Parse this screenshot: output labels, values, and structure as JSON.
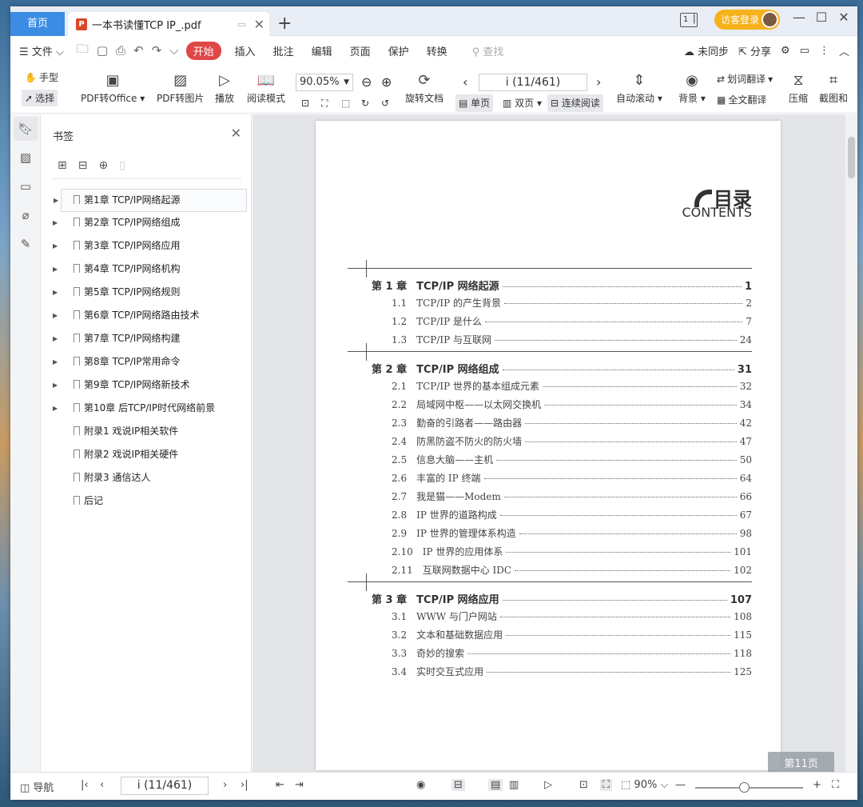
{
  "titlebar": {
    "home_tab": "首页",
    "doc_tab": "一本书读懂TCP IP_.pdf",
    "pdf_badge": "P",
    "new_tab": "+",
    "visitor_login": "访客登录",
    "min": "—",
    "max": "☐",
    "close": "✕"
  },
  "menubar": {
    "file": "文件",
    "start": "开始",
    "insert": "插入",
    "annotate": "批注",
    "edit": "编辑",
    "page": "页面",
    "protect": "保护",
    "convert": "转换",
    "search": "查找",
    "not_synced": "未同步",
    "share": "分享"
  },
  "toolbar": {
    "hand": "手型",
    "select": "选择",
    "pdf_to_office": "PDF转Office",
    "pdf_to_image": "PDF转图片",
    "play": "播放",
    "reading_mode": "阅读模式",
    "zoom": "90.05%",
    "page_input": "i (11/461)",
    "rotate_doc": "旋转文档",
    "single_page": "单页",
    "double_page": "双页",
    "continuous": "连续阅读",
    "auto_scroll": "自动滚动",
    "background": "背景",
    "word_translate": "划词翻译",
    "full_translate": "全文翻译",
    "compress": "压缩",
    "screenshot": "截图和"
  },
  "bookmarks": {
    "title": "书签",
    "items": [
      {
        "label": "第1章 TCP/IP网络起源",
        "expandable": true
      },
      {
        "label": "第2章 TCP/IP网络组成",
        "expandable": true
      },
      {
        "label": "第3章 TCP/IP网络应用",
        "expandable": true
      },
      {
        "label": "第4章 TCP/IP网络机构",
        "expandable": true
      },
      {
        "label": "第5章 TCP/IP网络规则",
        "expandable": true
      },
      {
        "label": "第6章 TCP/IP网络路由技术",
        "expandable": true
      },
      {
        "label": "第7章 TCP/IP网络构建",
        "expandable": true
      },
      {
        "label": "第8章 TCP/IP常用命令",
        "expandable": true
      },
      {
        "label": "第9章 TCP/IP网络新技术",
        "expandable": true
      },
      {
        "label": "第10章 后TCP/IP时代网络前景",
        "expandable": true
      },
      {
        "label": "附录1 戏说IP相关软件",
        "expandable": false
      },
      {
        "label": "附录2 戏说IP相关硬件",
        "expandable": false
      },
      {
        "label": "附录3 通信达人",
        "expandable": false
      },
      {
        "label": "后记",
        "expandable": false
      }
    ]
  },
  "document": {
    "heading": "目录",
    "subheading": "CONTENTS",
    "toc": [
      {
        "kind": "chap",
        "num": "第 1 章",
        "title": "TCP/IP 网络起源",
        "page": "1"
      },
      {
        "kind": "sec",
        "num": "1.1",
        "title": "TCP/IP 的产生背景",
        "page": "2"
      },
      {
        "kind": "sec",
        "num": "1.2",
        "title": "TCP/IP 是什么",
        "page": "7"
      },
      {
        "kind": "sec",
        "num": "1.3",
        "title": "TCP/IP 与互联网",
        "page": "24"
      },
      {
        "kind": "chap",
        "num": "第 2 章",
        "title": "TCP/IP 网络组成",
        "page": "31"
      },
      {
        "kind": "sec",
        "num": "2.1",
        "title": "TCP/IP 世界的基本组成元素",
        "page": "32"
      },
      {
        "kind": "sec",
        "num": "2.2",
        "title": "局域网中枢——以太网交换机",
        "page": "34"
      },
      {
        "kind": "sec",
        "num": "2.3",
        "title": "勤奋的引路者——路由器",
        "page": "42"
      },
      {
        "kind": "sec",
        "num": "2.4",
        "title": "防黑防盗不防火的防火墙",
        "page": "47"
      },
      {
        "kind": "sec",
        "num": "2.5",
        "title": "信息大脑——主机",
        "page": "50"
      },
      {
        "kind": "sec",
        "num": "2.6",
        "title": "丰富的 IP 终端",
        "page": "64"
      },
      {
        "kind": "sec",
        "num": "2.7",
        "title": "我是猫——Modem",
        "page": "66"
      },
      {
        "kind": "sec",
        "num": "2.8",
        "title": "IP 世界的道路构成",
        "page": "67"
      },
      {
        "kind": "sec",
        "num": "2.9",
        "title": "IP 世界的管理体系构造",
        "page": "98"
      },
      {
        "kind": "sec",
        "num": "2.10",
        "title": "IP 世界的应用体系",
        "page": "101"
      },
      {
        "kind": "sec",
        "num": "2.11",
        "title": "互联网数据中心 IDC",
        "page": "102"
      },
      {
        "kind": "chap",
        "num": "第 3 章",
        "title": "TCP/IP 网络应用",
        "page": "107"
      },
      {
        "kind": "sec",
        "num": "3.1",
        "title": "WWW 与门户网站",
        "page": "108"
      },
      {
        "kind": "sec",
        "num": "3.2",
        "title": "文本和基础数据应用",
        "page": "115"
      },
      {
        "kind": "sec",
        "num": "3.3",
        "title": "奇妙的搜索",
        "page": "118"
      },
      {
        "kind": "sec",
        "num": "3.4",
        "title": "实时交互式应用",
        "page": "125"
      }
    ],
    "page_badge": "第11页"
  },
  "statusbar": {
    "nav": "导航",
    "page_input": "i (11/461)",
    "zoom": "90%",
    "zoom_level": 0.45
  }
}
